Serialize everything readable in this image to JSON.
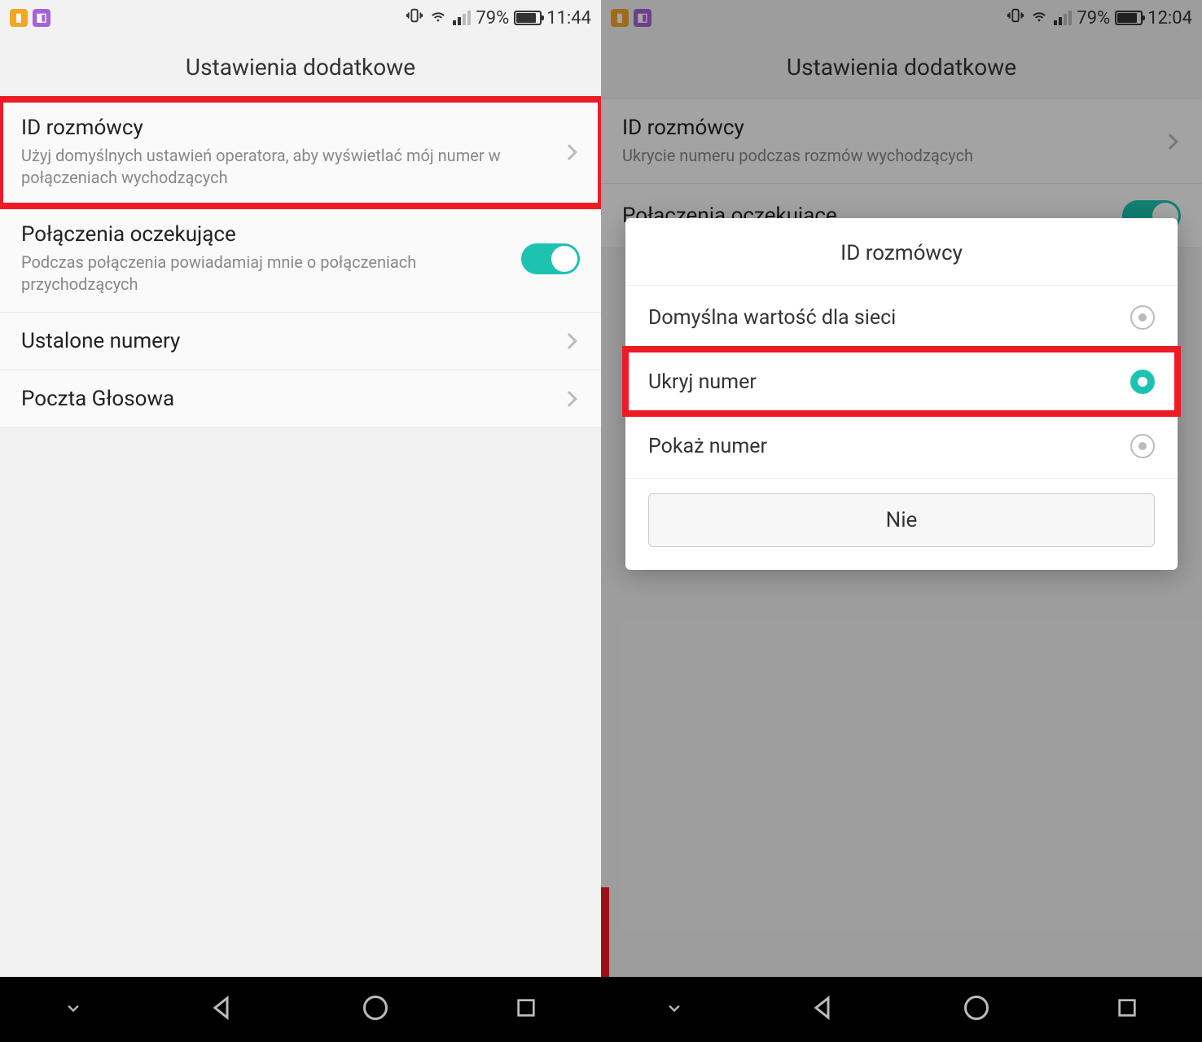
{
  "left": {
    "status": {
      "battery": "79%",
      "time": "11:44"
    },
    "header": "Ustawienia dodatkowe",
    "rows": {
      "caller_id": {
        "title": "ID rozmówcy",
        "sub": "Użyj domyślnych ustawień operatora, aby wyświetlać mój numer w połączeniach wychodzących"
      },
      "call_waiting": {
        "title": "Połączenia oczekujące",
        "sub": "Podczas połączenia powiadamiaj mnie o połączeniach przychodzących"
      },
      "fixed_numbers": {
        "title": "Ustalone numery"
      },
      "voicemail": {
        "title": "Poczta Głosowa"
      }
    }
  },
  "right": {
    "status": {
      "battery": "79%",
      "time": "12:04"
    },
    "header": "Ustawienia dodatkowe",
    "rows": {
      "caller_id": {
        "title": "ID rozmówcy",
        "sub": "Ukrycie numeru podczas rozmów wychodzących"
      },
      "call_waiting": {
        "title": "Połączenia oczekujące"
      }
    },
    "dialog": {
      "title": "ID rozmówcy",
      "options": {
        "network_default": "Domyślna wartość dla sieci",
        "hide": "Ukryj numer",
        "show": "Pokaż numer"
      },
      "cancel": "Nie"
    }
  }
}
